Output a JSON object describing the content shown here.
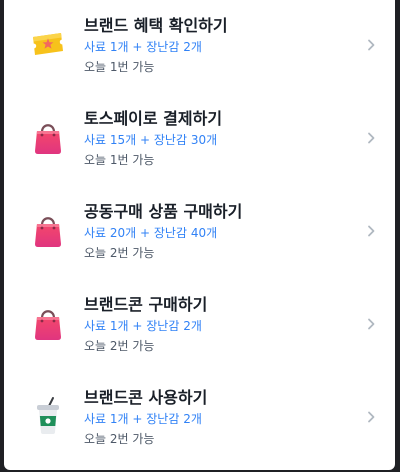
{
  "missions": [
    {
      "title": "브랜드 혜택 확인하기",
      "reward": "사료 1개 + 장난감 2개",
      "limit": "오늘 1번 가능",
      "icon": "ticket-icon"
    },
    {
      "title": "토스페이로 결제하기",
      "reward": "사료 15개 + 장난감 30개",
      "limit": "오늘 1번 가능",
      "icon": "shopping-bag-icon"
    },
    {
      "title": "공동구매 상품 구매하기",
      "reward": "사료 20개 + 장난감 40개",
      "limit": "오늘 2번 가능",
      "icon": "shopping-bag-icon"
    },
    {
      "title": "브랜드콘 구매하기",
      "reward": "사료 1개 + 장난감 2개",
      "limit": "오늘 2번 가능",
      "icon": "shopping-bag-icon"
    },
    {
      "title": "브랜드콘 사용하기",
      "reward": "사료 1개 + 장난감 2개",
      "limit": "오늘 2번 가능",
      "icon": "drink-cup-icon"
    }
  ],
  "colors": {
    "reward_text": "#3182f6",
    "title_text": "#191f28",
    "subtext": "#4e5968"
  }
}
